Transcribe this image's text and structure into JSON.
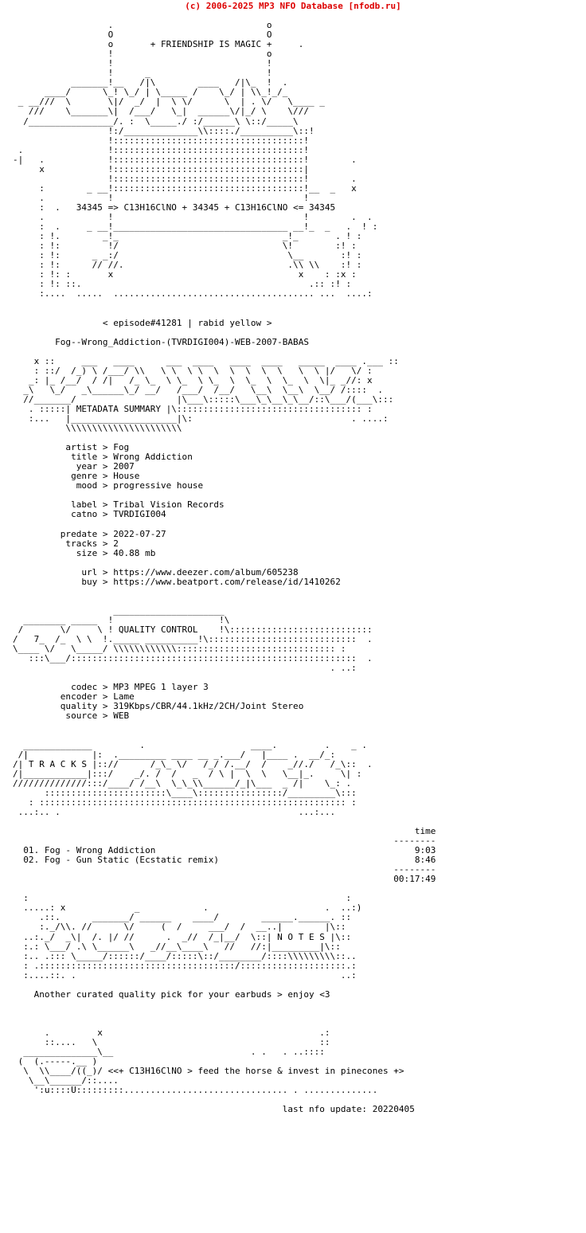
{
  "header": {
    "copyright": "(c) 2006-2025 MP3 NFO Database [nfodb.ru]",
    "color": "#dd0000"
  },
  "banner": {
    "tagline": "+ FRIENDSHIP IS MAGIC +",
    "formula_line": "34345 => C13H16ClNO + 34345 + C13H16ClNO <= 34345",
    "episode": "< episode#41281 | rabid yellow >",
    "release": "Fog--Wrong_Addiction-(TVRDIGI004)-WEB-2007-BABAS"
  },
  "sections": {
    "metadata_title": "METADATA SUMMARY",
    "quality_title": "QUALITY CONTROL",
    "tracks_title": "T R A C K S",
    "notes_title": "N O T E S"
  },
  "metadata": {
    "separator": ">",
    "fields": [
      {
        "label": "artist",
        "value": "Fog"
      },
      {
        "label": "title",
        "value": "Wrong Addiction"
      },
      {
        "label": "year",
        "value": "2007"
      },
      {
        "label": "genre",
        "value": "House"
      },
      {
        "label": "mood",
        "value": "progressive house"
      },
      {
        "label": "label",
        "value": "Tribal Vision Records"
      },
      {
        "label": "catno",
        "value": "TVRDIGI004"
      },
      {
        "label": "predate",
        "value": "2022-07-27"
      },
      {
        "label": "tracks",
        "value": "2"
      },
      {
        "label": "size",
        "value": "40.88 mb"
      },
      {
        "label": "url",
        "value": "https://www.deezer.com/album/605238"
      },
      {
        "label": "buy",
        "value": "https://www.beatport.com/release/id/1410262"
      }
    ]
  },
  "quality": {
    "fields": [
      {
        "label": "codec",
        "value": "MP3 MPEG 1 layer 3"
      },
      {
        "label": "encoder",
        "value": "Lame"
      },
      {
        "label": "quality",
        "value": "319Kbps/CBR/44.1kHz/2CH/Joint Stereo"
      },
      {
        "label": "source",
        "value": "WEB"
      }
    ]
  },
  "tracklist": {
    "time_header": "time",
    "rule": "--------",
    "items": [
      {
        "num": "01.",
        "title": "Fog - Wrong Addiction",
        "time": "9:03"
      },
      {
        "num": "02.",
        "title": "Fog - Gun Static (Ecstatic remix)",
        "time": "8:46"
      }
    ],
    "total": "00:17:49"
  },
  "notes": {
    "text": "Another curated quality pick for your earbuds > enjoy <3"
  },
  "footer": {
    "tagline": "<<+ C13H16ClNO > feed the horse & invest in pinecones +>",
    "last_update": "last nfo update: 20220405"
  },
  "ascii": {
    "logo_top": [
      "                  .                                      O",
      "                  O                                      .",
      "                  o           + FRIENDSHIP IS MAGIC +    o",
      "                  !                                      !",
      "                  !            _                         !   _",
      "                  !          _/ \\_           _/\\_        !  / /",
      "            ____  !___     _/    \\_        _/    \\___    ! //",
      "       ___ /    \\_!   \\_ _/  ___  \\_  ____/  ___   \\_\\  _!/ /____",
      "  _ __///  \\      \\!/  /_/  /   \\  \\ /    \\_/   \\   \\ \\/ /      \\___ _",
      "   ///   \\__\\____/ !  /_/   \\____\\  \\\\____/ \\____\\__/\\/  \\___///",
      "  /_________/     !. /   .   \\____\\/.:::::./\\____/  \\::/",
      "                  !:/______________\\\\.:::::/_________\\::!",
      "                  !:::::::::::::::::::::::::::::::::::::!"
    ]
  }
}
